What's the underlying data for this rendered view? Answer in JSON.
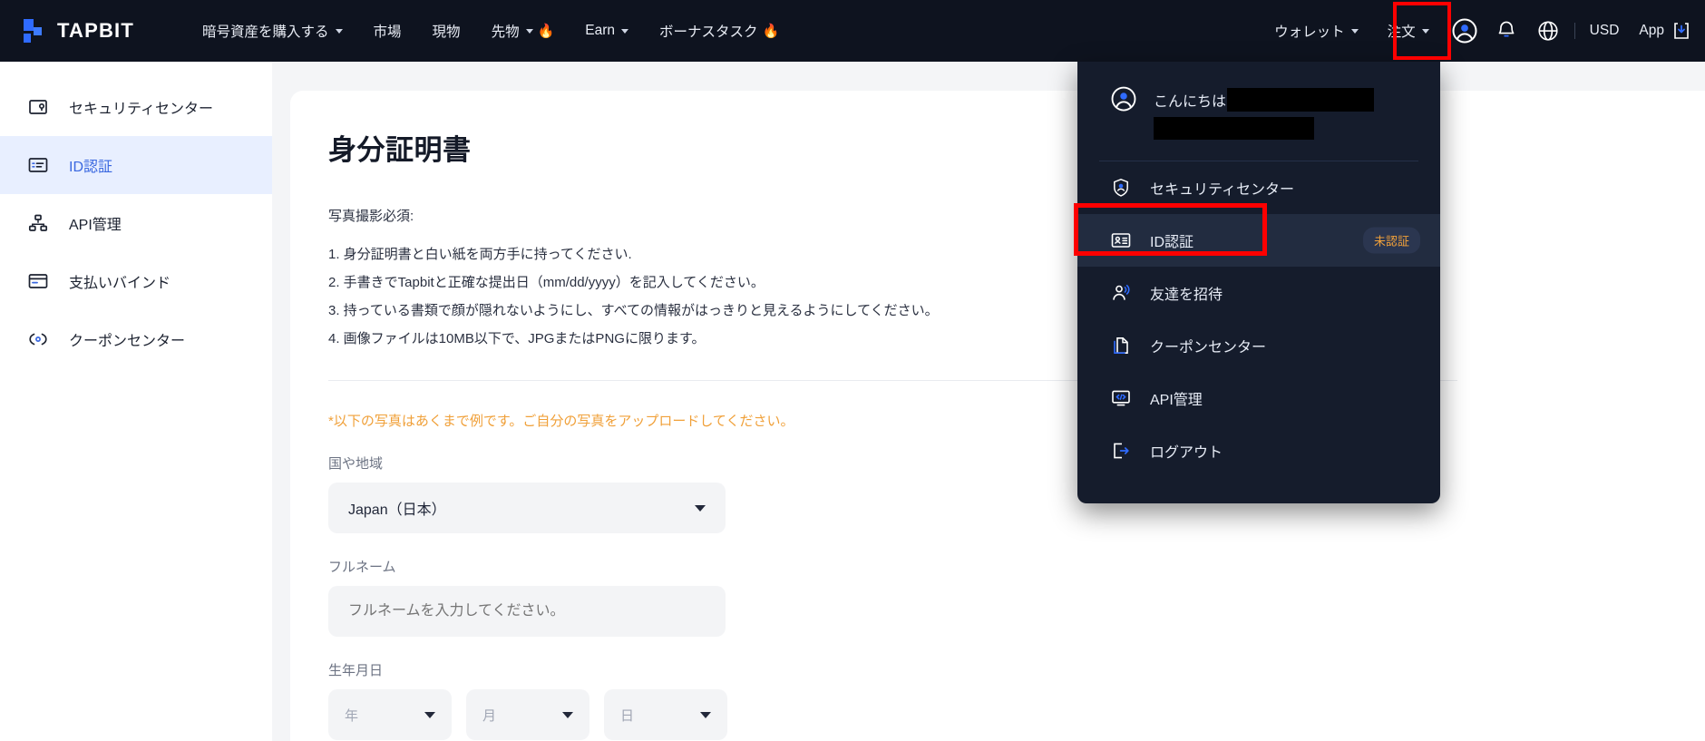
{
  "header": {
    "brand": "TAPBIT",
    "nav": [
      {
        "label": "暗号資産を購入する",
        "caret": true,
        "fire": false
      },
      {
        "label": "市場",
        "caret": false,
        "fire": false
      },
      {
        "label": "現物",
        "caret": false,
        "fire": false
      },
      {
        "label": "先物",
        "caret": true,
        "fire": true
      },
      {
        "label": "Earn",
        "caret": true,
        "fire": false
      },
      {
        "label": "ボーナスタスク",
        "caret": false,
        "fire": true
      }
    ],
    "right": {
      "wallet": "ウォレット",
      "orders": "注文",
      "currency": "USD",
      "app": "App",
      "avatar_icon": "user-circle-icon",
      "bell_icon": "bell-icon",
      "globe_icon": "globe-icon",
      "download_icon": "download-box-icon"
    }
  },
  "sidebar": {
    "items": [
      {
        "label": "セキュリティセンター",
        "icon": "security-center-icon",
        "active": false
      },
      {
        "label": "ID認証",
        "icon": "id-card-icon",
        "active": true
      },
      {
        "label": "API管理",
        "icon": "api-nodes-icon",
        "active": false
      },
      {
        "label": "支払いバインド",
        "icon": "payment-card-icon",
        "active": false
      },
      {
        "label": "クーポンセンター",
        "icon": "coupon-icon",
        "active": false
      }
    ]
  },
  "main": {
    "title": "身分証明書",
    "requirement_label": "写真撮影必須:",
    "requirements": [
      "1. 身分証明書と白い紙を両方手に持ってください.",
      "2. 手書きでTapbitと正確な提出日（mm/dd/yyyy）を記入してください。",
      "3. 持っている書類で顔が隠れないようにし、すべての情報がはっきりと見えるようにしてください。",
      "4. 画像ファイルは10MB以下で、JPGまたはPNGに限ります。"
    ],
    "note": "*以下の写真はあくまで例です。ご自分の写真をアップロードしてください。",
    "form": {
      "country_label": "国や地域",
      "country_value": "Japan（日本）",
      "fullname_label": "フルネーム",
      "fullname_placeholder": "フルネームを入力してください。",
      "fullname_value": "",
      "dob_label": "生年月日",
      "dob_year": "年",
      "dob_month": "月",
      "dob_day": "日"
    }
  },
  "dropdown": {
    "greeting": "こんにちは",
    "items": [
      {
        "label": "セキュリティセンター",
        "icon": "shield-user-icon",
        "badge": "",
        "highlight": false
      },
      {
        "label": "ID認証",
        "icon": "id-card-icon",
        "badge": "未認証",
        "highlight": true
      },
      {
        "label": "友達を招待",
        "icon": "invite-friends-icon",
        "badge": "",
        "highlight": false
      },
      {
        "label": "クーポンセンター",
        "icon": "coupon-doc-icon",
        "badge": "",
        "highlight": false
      },
      {
        "label": "API管理",
        "icon": "api-code-icon",
        "badge": "",
        "highlight": false
      },
      {
        "label": "ログアウト",
        "icon": "logout-icon",
        "badge": "",
        "highlight": false
      }
    ]
  },
  "colors": {
    "header_bg": "#0e131f",
    "dropdown_bg": "#151c2c",
    "accent_blue": "#2f6bff",
    "sidebar_active_bg": "#e8efff",
    "sidebar_active_text": "#3a68e0",
    "note_orange": "#f0a039",
    "badge_orange": "#f0a03a",
    "annotation_red": "#ff0000"
  }
}
